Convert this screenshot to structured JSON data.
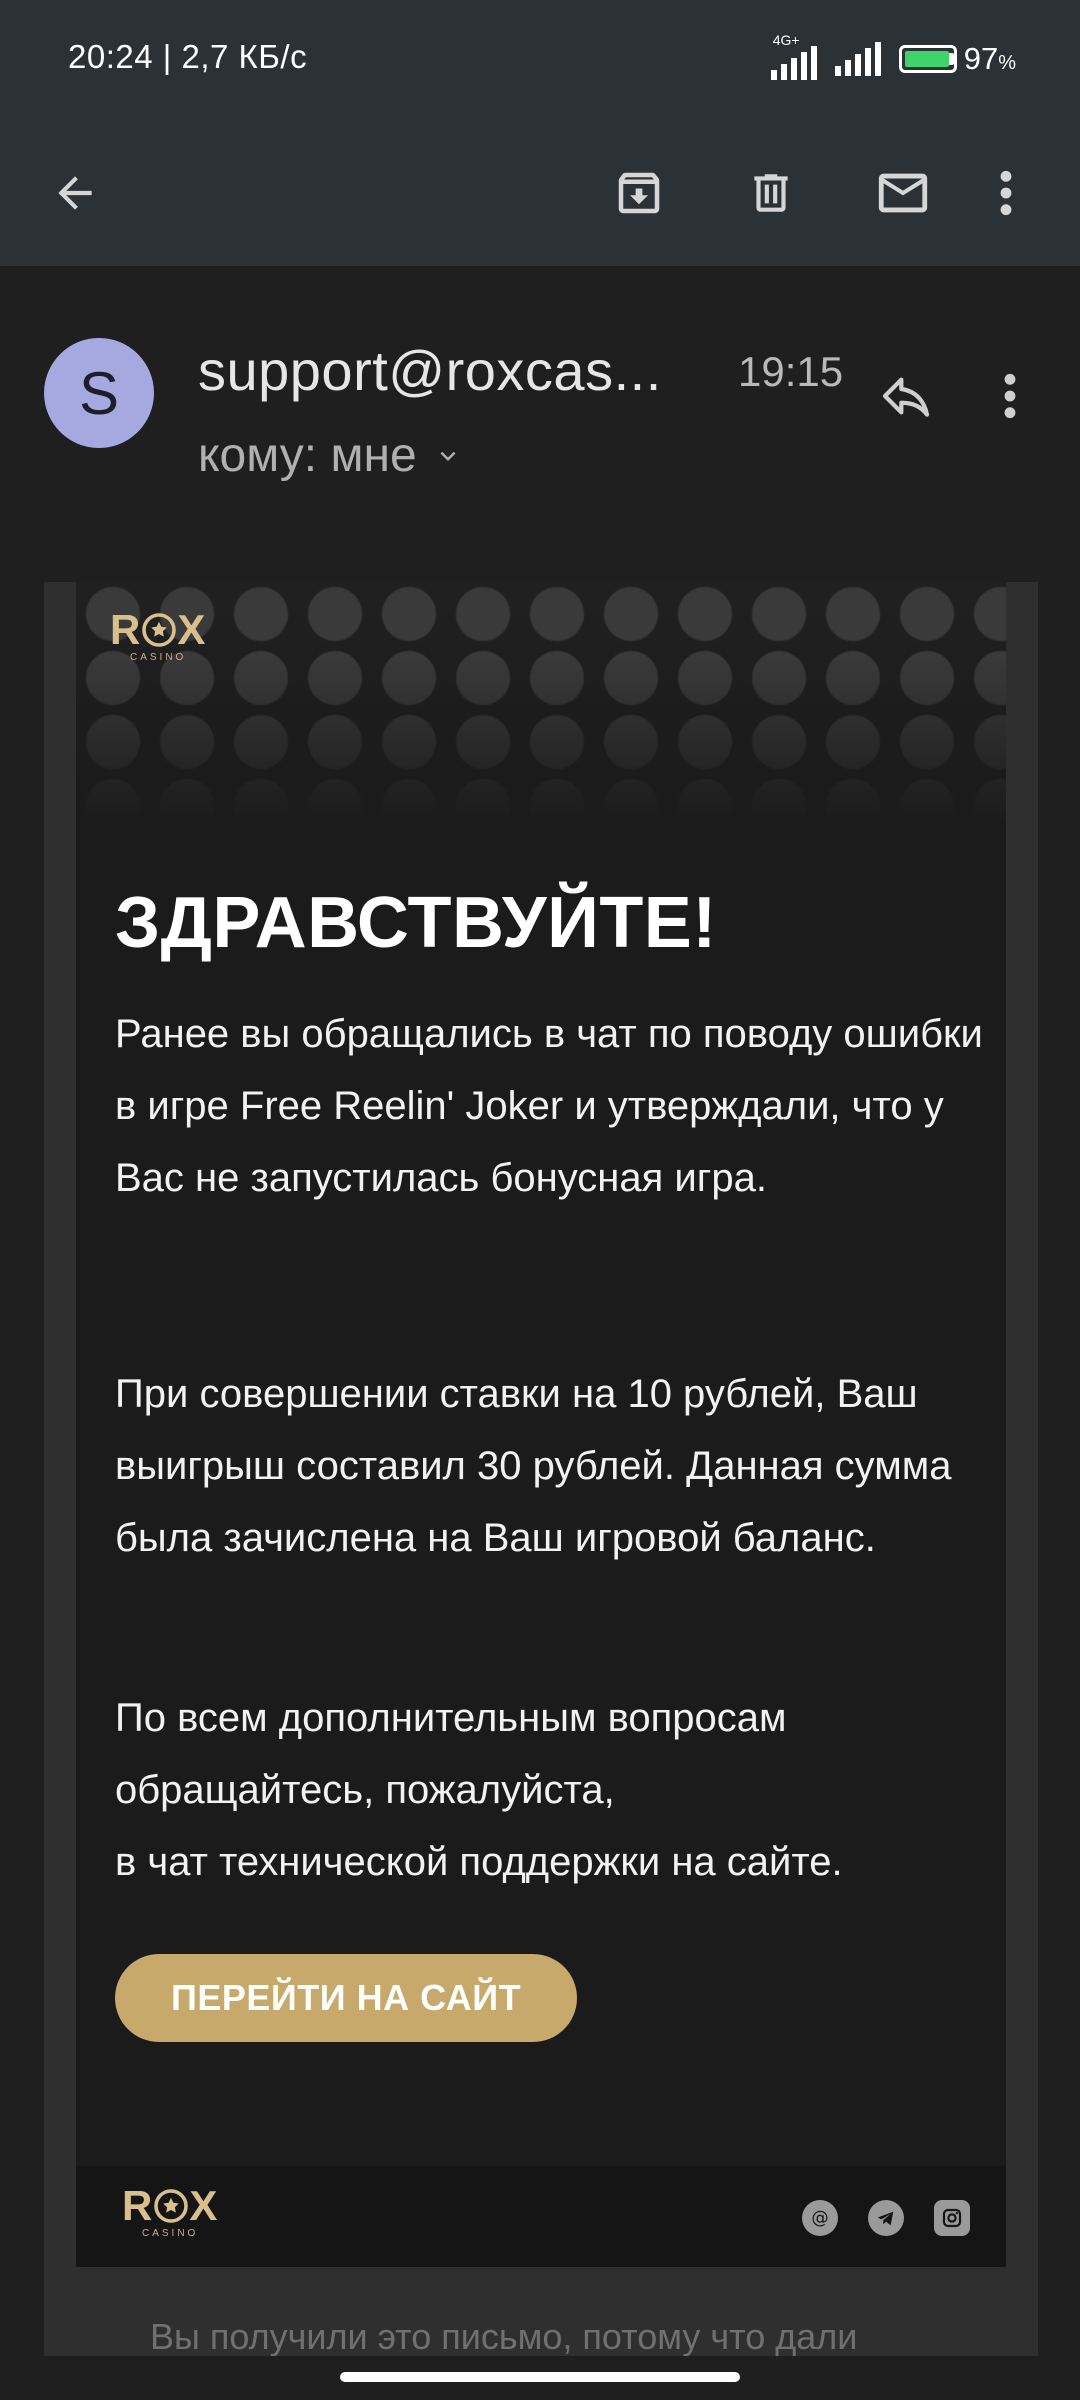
{
  "status_bar": {
    "time_speed": "20:24 | 2,7 КБ/с",
    "network_label": "4G+",
    "battery_level": "97",
    "battery_unit": "%"
  },
  "toolbar": {
    "back_icon": "arrow-left-icon",
    "archive_icon": "archive-icon",
    "delete_icon": "trash-icon",
    "mark_unread_icon": "mail-icon",
    "more_icon": "more-vert-icon"
  },
  "message": {
    "avatar_letter": "S",
    "sender": "support@roxcas...",
    "time": "19:15",
    "recipient": "кому: мне"
  },
  "email": {
    "logo_word_left": "R",
    "logo_word_right": "X",
    "logo_sub": "CASINO",
    "greeting": "ЗДРАВСТВУЙТЕ!",
    "paragraph_1": "Ранее вы обращались в чат по поводу ошибки в игре Free Reelin' Joker и утверждали, что у Вас не запустилась бонусная игра.",
    "paragraph_2": "При совершении ставки на 10 рублей, Ваш выигрыш составил 30 рублей. Данная сумма была зачислена на Ваш игровой баланс.",
    "paragraph_3_line_1": "По всем дополнительным вопросам обращайтесь, пожалуйста,",
    "paragraph_3_line_2": "в чат технической поддержки на сайте.",
    "cta_label": "ПЕРЕЙТИ НА САЙТ",
    "footer_icons": [
      "email-icon",
      "telegram-icon",
      "instagram-icon"
    ],
    "disclaimer": "Вы получили это письмо, потому что дали"
  },
  "colors": {
    "accent_gold": "#c8a96c",
    "toolbar_bg": "#2c3136",
    "avatar_bg": "#a6a9e0"
  }
}
